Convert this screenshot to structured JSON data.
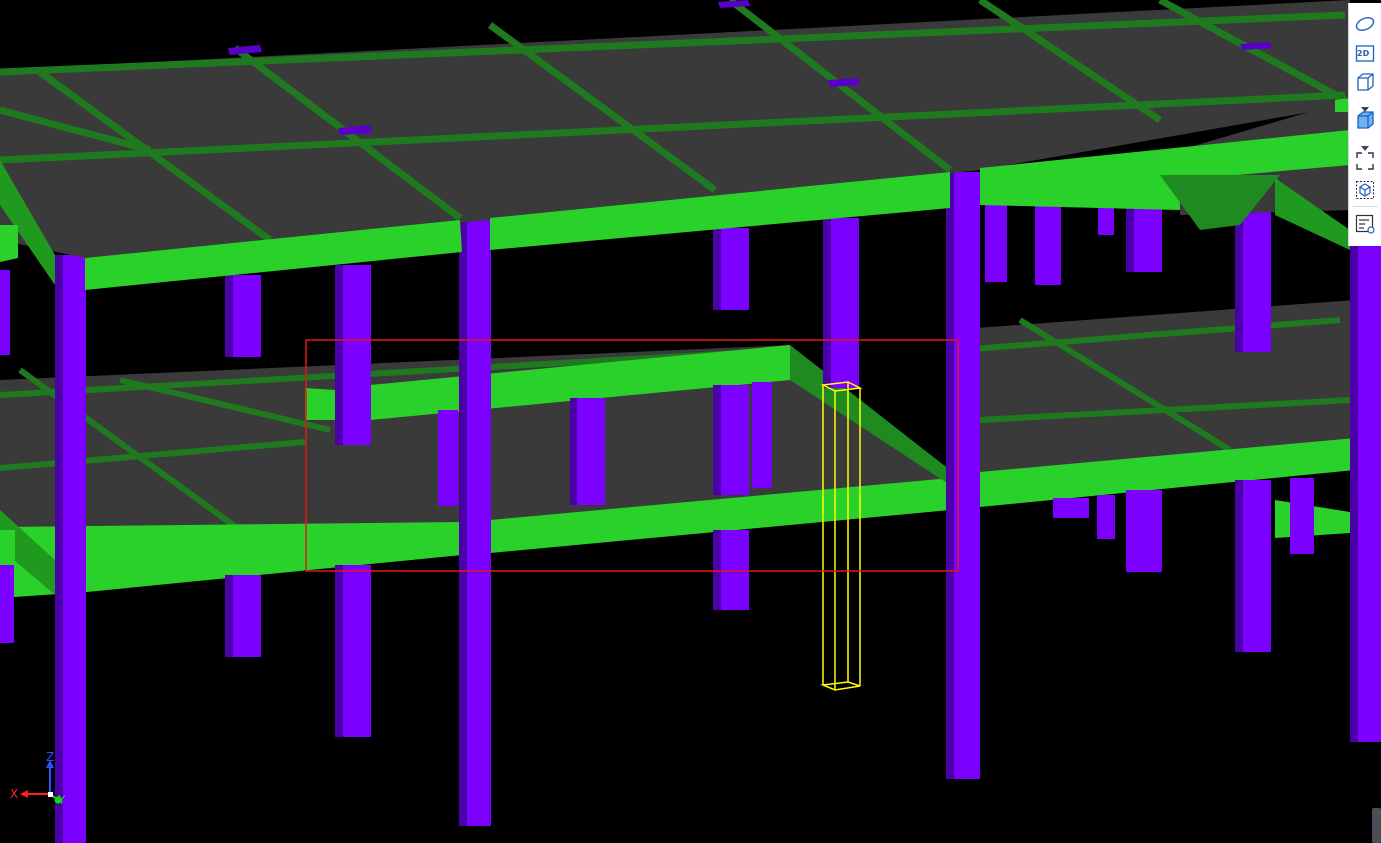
{
  "viewport": {
    "background": "#000000",
    "colors": {
      "slab": "#3a3a3a",
      "beam": "#2bd12b",
      "beam_dark": "#1f8a1f",
      "column": "#7b00ff",
      "column_dark": "#4b00a8",
      "selection_box": "#e01818",
      "highlight": "#ffff00"
    }
  },
  "toolbar": {
    "view_2d_label": "2D",
    "buttons": [
      {
        "name": "orbit-icon",
        "interactable": true
      },
      {
        "name": "view-2d-button",
        "interactable": true
      },
      {
        "name": "view-3d-cube-icon",
        "interactable": true
      },
      {
        "name": "shaded-cube-icon",
        "interactable": true
      },
      {
        "name": "zoom-extents-icon",
        "interactable": true
      },
      {
        "name": "isolate-selection-icon",
        "interactable": true
      },
      {
        "name": "properties-panel-icon",
        "interactable": true
      }
    ]
  },
  "axis_indicator": {
    "x_label": "X",
    "y_label": "Y",
    "z_label": "Z",
    "x_color": "#ff2020",
    "y_color": "#19d619",
    "z_color": "#2a52ff"
  }
}
